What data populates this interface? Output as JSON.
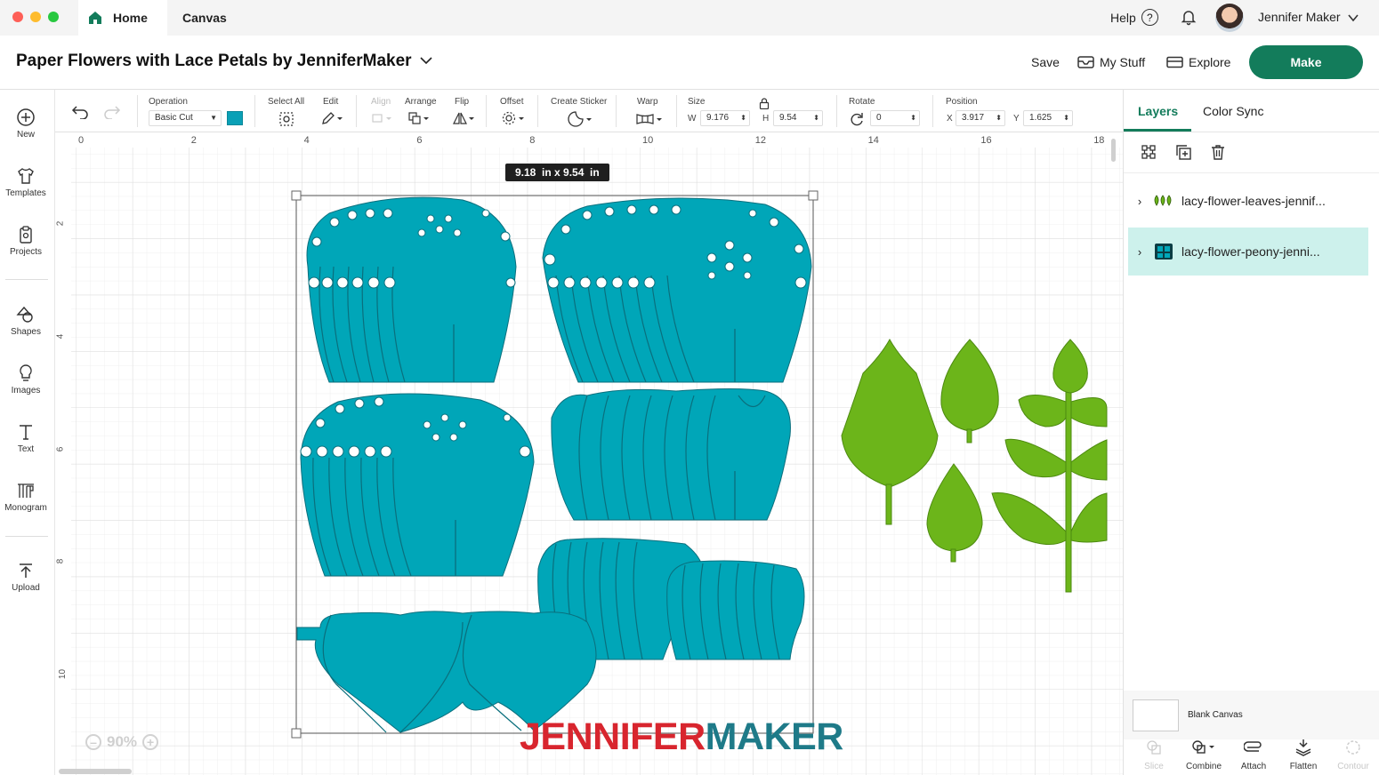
{
  "titlebar": {
    "home_label": "Home",
    "canvas_label": "Canvas",
    "help_label": "Help",
    "help_icon": "?",
    "user_name": "Jennifer Maker"
  },
  "header": {
    "project_title": "Paper Flowers with Lace Petals by JenniferMaker",
    "save_label": "Save",
    "mystuff_label": "My Stuff",
    "explore_label": "Explore",
    "make_label": "Make"
  },
  "leftbar": {
    "items": [
      {
        "label": "New"
      },
      {
        "label": "Templates"
      },
      {
        "label": "Projects"
      },
      {
        "label": "Shapes"
      },
      {
        "label": "Images"
      },
      {
        "label": "Text"
      },
      {
        "label": "Monogram"
      },
      {
        "label": "Upload"
      }
    ]
  },
  "toolbar": {
    "operation_label": "Operation",
    "operation_value": "Basic Cut",
    "operation_color": "#0aa0b6",
    "select_all_label": "Select All",
    "edit_label": "Edit",
    "align_label": "Align",
    "arrange_label": "Arrange",
    "flip_label": "Flip",
    "offset_label": "Offset",
    "create_sticker_label": "Create Sticker",
    "warp_label": "Warp",
    "size_label": "Size",
    "w_label": "W",
    "w_value": "9.176",
    "h_label": "H",
    "h_value": "9.54",
    "rotate_label": "Rotate",
    "rotate_value": "0",
    "position_label": "Position",
    "x_label": "X",
    "x_value": "3.917",
    "y_label": "Y",
    "y_value": "1.625"
  },
  "canvas": {
    "top_ticks": [
      "0",
      "2",
      "4",
      "6",
      "8",
      "10",
      "12",
      "14",
      "16",
      "18"
    ],
    "left_ticks": [
      "2",
      "4",
      "6",
      "8",
      "10"
    ],
    "size_tooltip": "9.18  in x 9.54  in",
    "zoom_label": "90%",
    "watermark_left": "JENNIFER",
    "watermark_right": "MAKER",
    "petal_color": "#00a6b8",
    "leaf_color": "#6cb51a"
  },
  "rightpanel": {
    "tabs": [
      "Layers",
      "Color Sync"
    ],
    "layers": [
      {
        "name": "lacy-flower-leaves-jennif..."
      },
      {
        "name": "lacy-flower-peony-jenni..."
      }
    ],
    "blank_canvas_label": "Blank Canvas",
    "bottom_tools": [
      {
        "label": "Slice"
      },
      {
        "label": "Combine"
      },
      {
        "label": "Attach"
      },
      {
        "label": "Flatten"
      },
      {
        "label": "Contour"
      }
    ]
  }
}
